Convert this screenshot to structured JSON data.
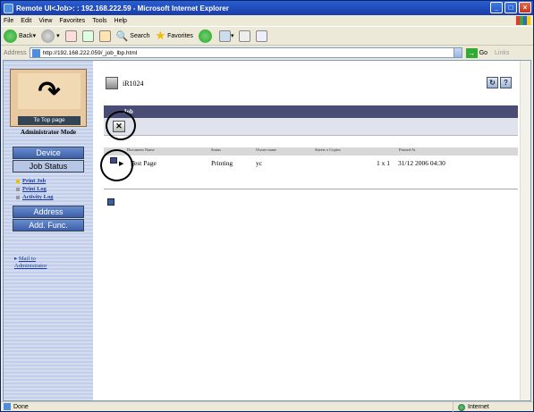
{
  "window": {
    "title": "Remote UI<Job>: : 192.168.222.59 - Microsoft Internet Explorer"
  },
  "menu": [
    "File",
    "Edit",
    "View",
    "Favorites",
    "Tools",
    "Help"
  ],
  "toolbar": {
    "back": "Back",
    "search": "Search",
    "favorites": "Favorites"
  },
  "address": {
    "label": "Address",
    "url": "http://192.168.222.059/_job_lbp.html",
    "go": "Go",
    "links": "Links"
  },
  "sidebar": {
    "top_page": "To Top page",
    "mode": "Administrator Mode",
    "nav": {
      "device": "Device",
      "job_status": "Job Status",
      "address": "Address",
      "add_func": "Add. Func."
    },
    "sublinks": {
      "print_job": "Print Job",
      "print_log": "Print Log",
      "activity_log": "Activity Log"
    },
    "mail_line1": "Mail to",
    "mail_line2": "Administrator"
  },
  "main": {
    "device": "iR1024",
    "section_title": "Job",
    "table": {
      "headers": [
        "Document Name",
        "Status",
        "Owner name",
        "Sheets x Copies",
        "Printed At"
      ],
      "row": {
        "doc": "Test Page",
        "status": "Printing",
        "owner": "yc",
        "sheets": "1 x 1",
        "printed": "31/12 2006 04:30"
      }
    }
  },
  "status": {
    "text": "Done",
    "zone": "Internet"
  }
}
